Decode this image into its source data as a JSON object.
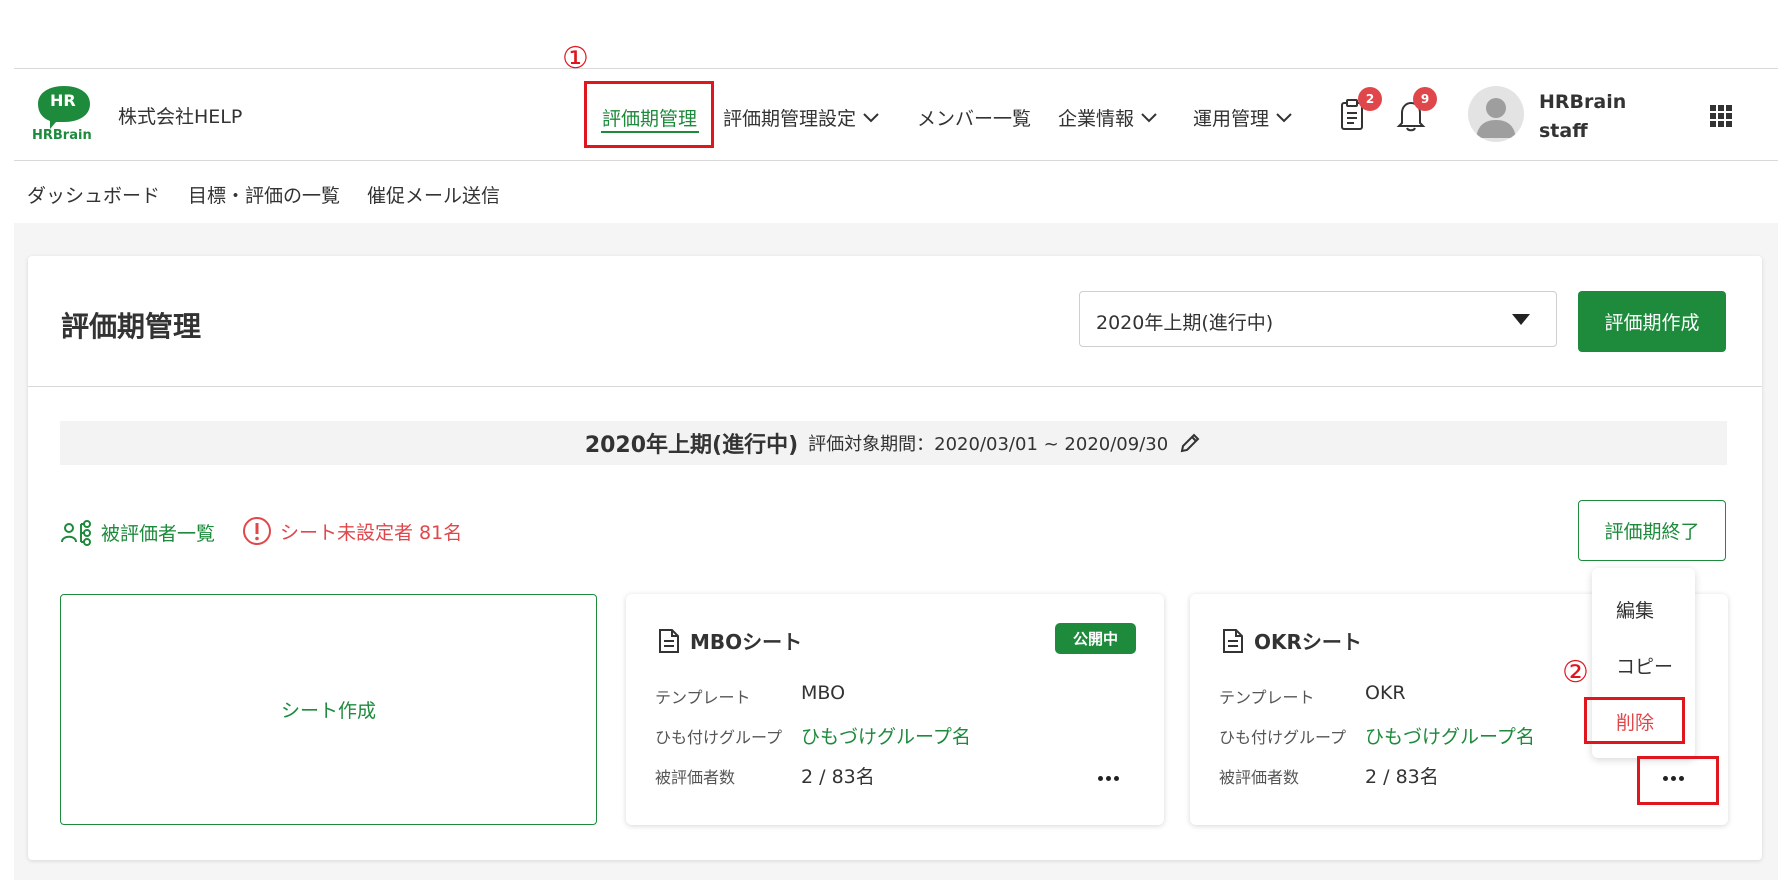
{
  "header": {
    "logo_text": "HR",
    "logo_wordmark": "HRBrain",
    "company": "株式会社HELP",
    "nav": [
      {
        "label": "評価期管理",
        "active": true
      },
      {
        "label": "評価期管理設定",
        "dropdown": true
      },
      {
        "label": "メンバー一覧"
      },
      {
        "label": "企業情報",
        "dropdown": true
      },
      {
        "label": "運用管理",
        "dropdown": true
      }
    ],
    "tasks_icon": "clipboard-icon",
    "tasks_badge": "2",
    "notifications_icon": "bell-icon",
    "notifications_badge": "9",
    "user": {
      "line1": "HRBrain",
      "line2": "staff"
    },
    "apps_icon": "grid-icon"
  },
  "subnav": [
    "ダッシュボード",
    "目標・評価の一覧",
    "催促メール送信"
  ],
  "main": {
    "title": "評価期管理",
    "period_select_value": "2020年上期(進行中)",
    "create_period_label": "評価期作成",
    "period_bar": {
      "name": "2020年上期(進行中)",
      "range": "評価対象期間：2020/03/01 ~ 2020/09/30"
    },
    "evaluatee_list_label": "被評価者一覧",
    "unset_warning": "シート未設定者 81名",
    "end_period_label": "評価期終了",
    "create_sheet_label": "シート作成",
    "sheets": [
      {
        "title": "MBOシート",
        "status": "公開中",
        "template_label": "テンプレート",
        "template_value": "MBO",
        "group_label": "ひも付けグループ",
        "group_value": "ひもづけグループ名",
        "count_label": "被評価者数",
        "count_value": "2 / 83名"
      },
      {
        "title": "OKRシート",
        "status": "",
        "template_label": "テンプレート",
        "template_value": "OKR",
        "group_label": "ひも付けグループ",
        "group_value": "ひもづけグループ名",
        "count_label": "被評価者数",
        "count_value": "2 / 83名"
      }
    ],
    "context_menu": [
      "編集",
      "コピー",
      "削除"
    ]
  },
  "annotations": [
    "①",
    "②"
  ],
  "colors": {
    "brand_green": "#1d8a3c",
    "danger_red": "#e0474b",
    "annotation_red": "#e0161f"
  }
}
